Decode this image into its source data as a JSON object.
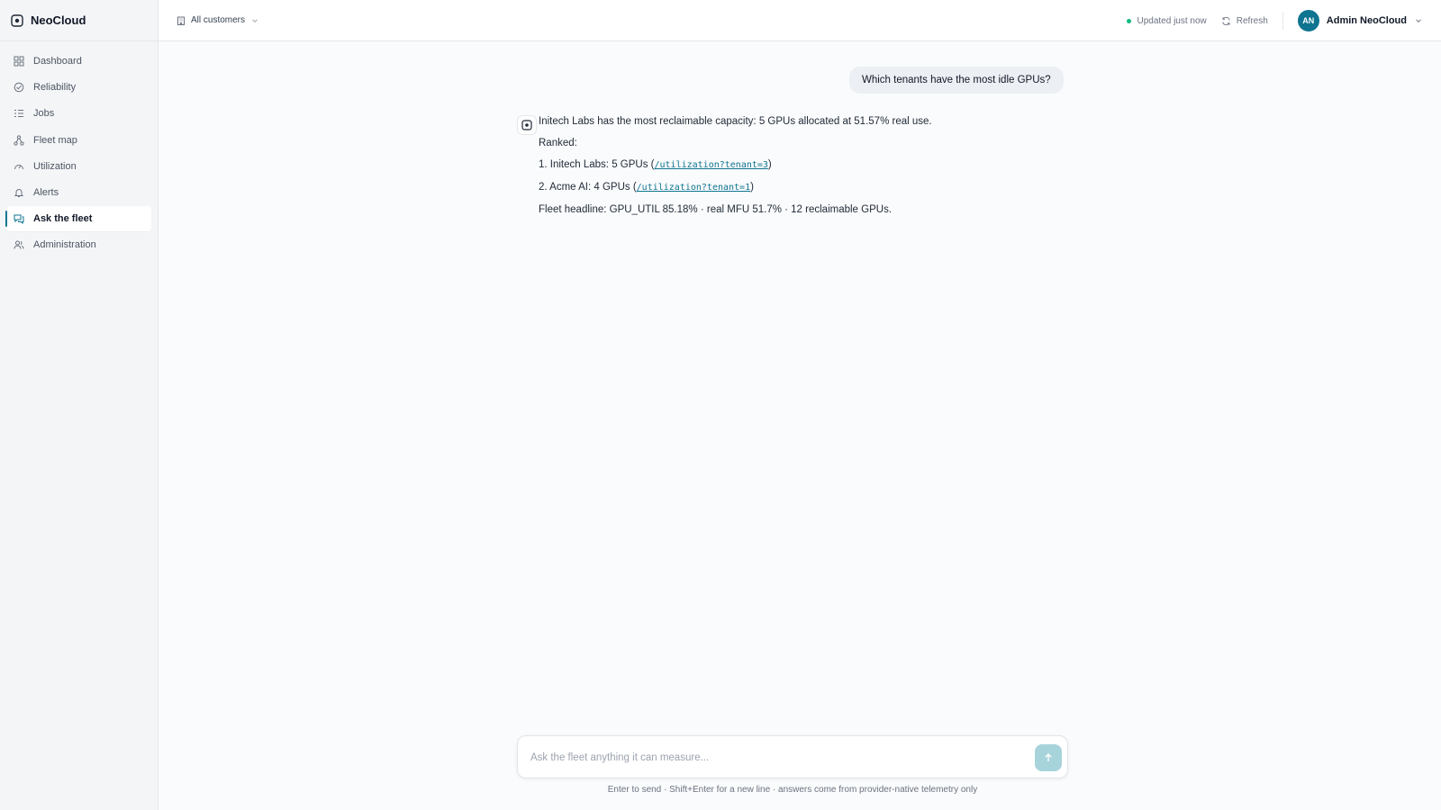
{
  "brand": {
    "name": "NeoCloud",
    "icon": "cloud-logo-icon"
  },
  "sidebar": {
    "items": [
      {
        "label": "Dashboard",
        "icon": "dashboard-icon"
      },
      {
        "label": "Reliability",
        "icon": "reliability-icon"
      },
      {
        "label": "Jobs",
        "icon": "jobs-icon"
      },
      {
        "label": "Fleet map",
        "icon": "fleet-map-icon"
      },
      {
        "label": "Utilization",
        "icon": "gauge-icon"
      },
      {
        "label": "Alerts",
        "icon": "bell-icon"
      },
      {
        "label": "Ask the fleet",
        "icon": "chat-icon",
        "active": true
      },
      {
        "label": "Administration",
        "icon": "users-icon"
      }
    ]
  },
  "topbar": {
    "customer_filter": "All customers",
    "updated": "Updated just now",
    "refresh_label": "Refresh",
    "user": {
      "initials": "AN",
      "name": "Admin NeoCloud"
    }
  },
  "chat": {
    "user_message": "Which tenants have the most idle GPUs?",
    "assistant": {
      "line1": "Initech Labs has the most reclaimable capacity: 5 GPUs allocated at 51.57% real use.",
      "line2": "Ranked:",
      "rank1_text": "1. Initech Labs: 5 GPUs (",
      "rank1_link": "/utilization?tenant=3",
      "rank1_close": ")",
      "rank2_text": "2. Acme AI: 4 GPUs (",
      "rank2_link": "/utilization?tenant=1",
      "rank2_close": ")",
      "headline": "Fleet headline: GPU_UTIL 85.18% · real MFU 51.7% · 12 reclaimable GPUs."
    }
  },
  "composer": {
    "placeholder": "Ask the fleet anything it can measure...",
    "value": "",
    "hint": "Enter to send · Shift+Enter for a new line · answers come from provider-native telemetry only"
  },
  "colors": {
    "accent": "#0e7490",
    "status_ok": "#10b981",
    "send_button": "#a7d4da"
  }
}
